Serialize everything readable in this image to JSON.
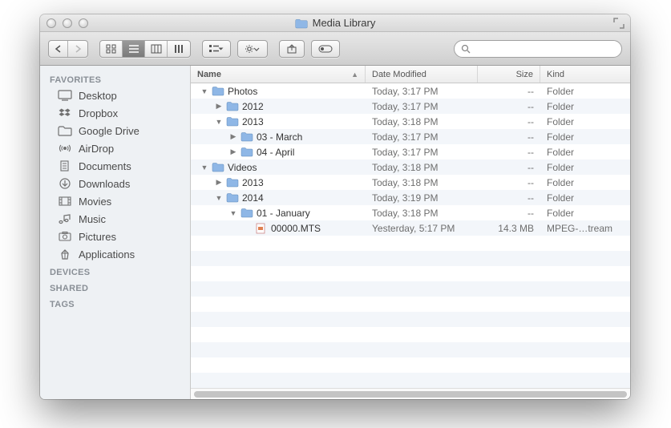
{
  "window": {
    "title": "Media Library"
  },
  "search": {
    "placeholder": ""
  },
  "sidebar": {
    "sections": [
      {
        "header": "FAVORITES",
        "items": [
          {
            "label": "Desktop",
            "icon": "desktop"
          },
          {
            "label": "Dropbox",
            "icon": "dropbox"
          },
          {
            "label": "Google Drive",
            "icon": "folder"
          },
          {
            "label": "AirDrop",
            "icon": "airdrop"
          },
          {
            "label": "Documents",
            "icon": "documents"
          },
          {
            "label": "Downloads",
            "icon": "downloads"
          },
          {
            "label": "Movies",
            "icon": "movies"
          },
          {
            "label": "Music",
            "icon": "music"
          },
          {
            "label": "Pictures",
            "icon": "pictures"
          },
          {
            "label": "Applications",
            "icon": "applications"
          }
        ]
      },
      {
        "header": "DEVICES",
        "items": []
      },
      {
        "header": "SHARED",
        "items": []
      },
      {
        "header": "TAGS",
        "items": []
      }
    ]
  },
  "columns": {
    "name": "Name",
    "date": "Date Modified",
    "size": "Size",
    "kind": "Kind"
  },
  "rows": [
    {
      "indent": 0,
      "disc": "down",
      "icon": "folder",
      "name": "Photos",
      "date": "Today, 3:17 PM",
      "size": "--",
      "kind": "Folder"
    },
    {
      "indent": 1,
      "disc": "right",
      "icon": "folder",
      "name": "2012",
      "date": "Today, 3:17 PM",
      "size": "--",
      "kind": "Folder"
    },
    {
      "indent": 1,
      "disc": "down",
      "icon": "folder",
      "name": "2013",
      "date": "Today, 3:18 PM",
      "size": "--",
      "kind": "Folder"
    },
    {
      "indent": 2,
      "disc": "right",
      "icon": "folder",
      "name": "03 - March",
      "date": "Today, 3:17 PM",
      "size": "--",
      "kind": "Folder"
    },
    {
      "indent": 2,
      "disc": "right",
      "icon": "folder",
      "name": "04 - April",
      "date": "Today, 3:17 PM",
      "size": "--",
      "kind": "Folder"
    },
    {
      "indent": 0,
      "disc": "down",
      "icon": "folder",
      "name": "Videos",
      "date": "Today, 3:18 PM",
      "size": "--",
      "kind": "Folder"
    },
    {
      "indent": 1,
      "disc": "right",
      "icon": "folder",
      "name": "2013",
      "date": "Today, 3:18 PM",
      "size": "--",
      "kind": "Folder"
    },
    {
      "indent": 1,
      "disc": "down",
      "icon": "folder",
      "name": "2014",
      "date": "Today, 3:19 PM",
      "size": "--",
      "kind": "Folder"
    },
    {
      "indent": 2,
      "disc": "down",
      "icon": "folder",
      "name": "01 - January",
      "date": "Today, 3:18 PM",
      "size": "--",
      "kind": "Folder"
    },
    {
      "indent": 3,
      "disc": "none",
      "icon": "file",
      "name": "00000.MTS",
      "date": "Yesterday, 5:17 PM",
      "size": "14.3 MB",
      "kind": "MPEG-…tream"
    }
  ]
}
